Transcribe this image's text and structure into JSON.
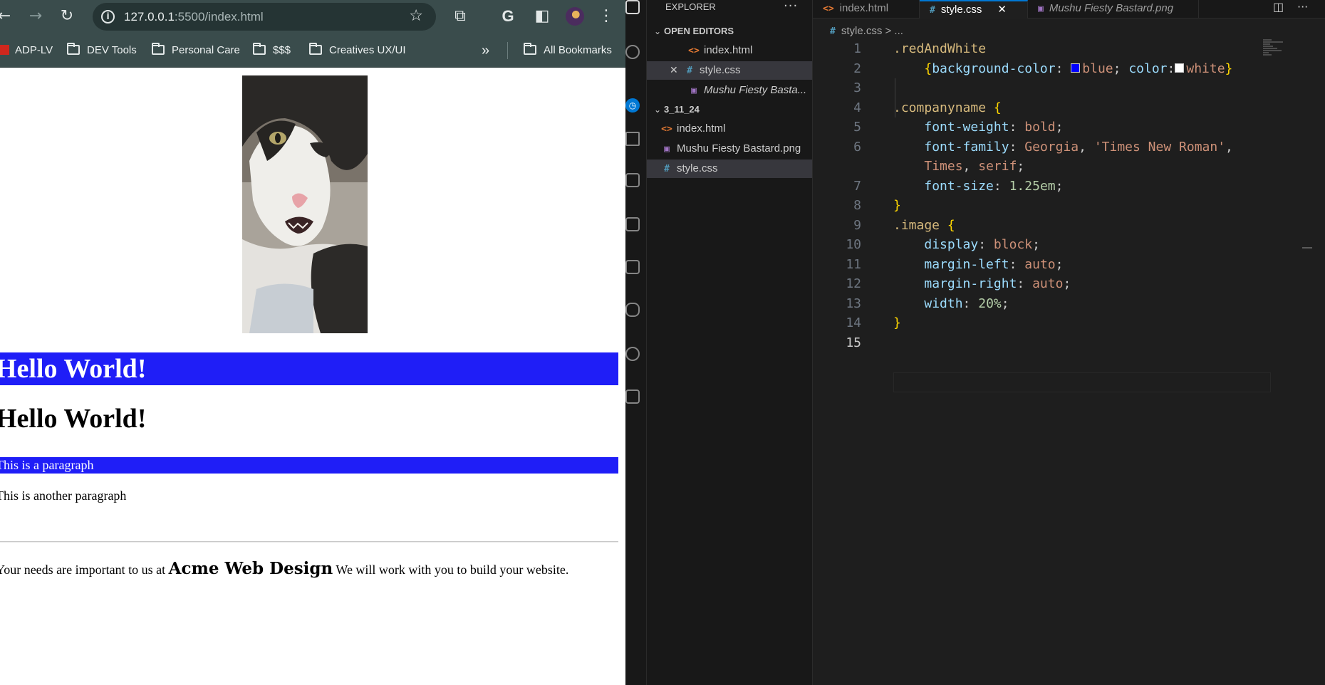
{
  "browser": {
    "url_host": "127.0.0.1",
    "url_rest": ":5500/index.html",
    "bookmarks": [
      "ADP-LV",
      "DEV Tools",
      "Personal Care",
      "$$$",
      "Creatives UX/UI"
    ],
    "more_bookmarks": "»",
    "all_bookmarks": "All Bookmarks"
  },
  "webpage": {
    "banner_heading": "Hello World!",
    "heading": "Hello World!",
    "banner_paragraph": "This is a paragraph",
    "paragraph": "This is another paragraph",
    "footer_before": "Your needs are important to us at ",
    "company_name": "Acme Web Design",
    "footer_after": " We will work with you to build your website."
  },
  "vscode": {
    "explorer_title": "EXPLORER",
    "explorer_more": "···",
    "open_editors_title": "OPEN EDITORS",
    "open_editors": [
      {
        "name": "index.html",
        "type": "html"
      },
      {
        "name": "style.css",
        "type": "css"
      },
      {
        "name": "Mushu Fiesty Basta...",
        "type": "png"
      }
    ],
    "folder_title": "3_11_24",
    "folder_files": [
      {
        "name": "index.html",
        "type": "html"
      },
      {
        "name": "Mushu Fiesty Bastard.png",
        "type": "png"
      },
      {
        "name": "style.css",
        "type": "css"
      }
    ],
    "tabs": [
      {
        "name": "index.html"
      },
      {
        "name": "style.css"
      },
      {
        "name": "Mushu Fiesty Bastard.png"
      }
    ],
    "breadcrumb": "style.css > ...",
    "line_numbers": [
      "1",
      "2",
      "3",
      "4",
      "5",
      "6",
      "",
      "7",
      "8",
      "9",
      "10",
      "11",
      "12",
      "13",
      "14",
      "15"
    ],
    "code": {
      "l1_sel": ".redAndWhite",
      "l2_open": "{",
      "l2_prop1": "background-color",
      "l2_val1": "blue",
      "l2_prop2": "color",
      "l2_val2": "white",
      "l2_close": "}",
      "l4_sel": ".companyname",
      "l5_prop": "font-weight",
      "l5_val": "bold",
      "l6_prop": "font-family",
      "l6_val1": "Georgia",
      "l6_val2": "'Times New Roman'",
      "l6b_val3": "Times",
      "l6b_val4": "serif",
      "l7_prop": "font-size",
      "l7_val": "1.25em",
      "l8_close": "}",
      "l9_sel": ".image",
      "l10_prop": "display",
      "l10_val": "block",
      "l11_prop": "margin-left",
      "l11_val": "auto",
      "l12_prop": "margin-right",
      "l12_val": "auto",
      "l13_prop": "width",
      "l13_val": "20%",
      "l14_close": "}"
    },
    "colors": {
      "blue_swatch": "#0000ff",
      "white_swatch": "#ffffff",
      "banner_bg": "#1f1ef7"
    }
  }
}
